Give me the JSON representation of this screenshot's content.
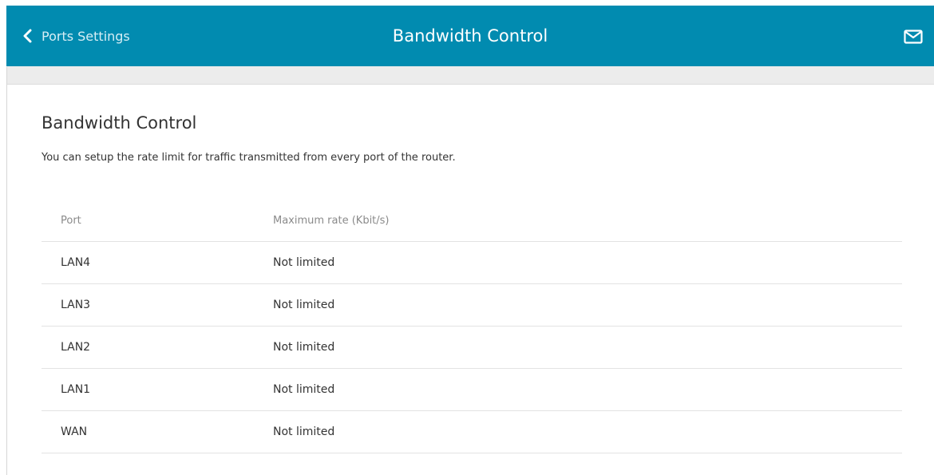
{
  "header": {
    "back_label": "Ports Settings",
    "title": "Bandwidth Control",
    "back_icon": "chevron-left-icon",
    "mail_icon": "mail-icon",
    "bar_color": "#018bb0"
  },
  "section": {
    "title": "Bandwidth Control",
    "description": "You can setup the rate limit for traffic transmitted from every port of the router."
  },
  "table": {
    "columns": [
      "Port",
      "Maximum rate (Kbit/s)"
    ],
    "rows": [
      {
        "port": "LAN4",
        "rate": "Not limited"
      },
      {
        "port": "LAN3",
        "rate": "Not limited"
      },
      {
        "port": "LAN2",
        "rate": "Not limited"
      },
      {
        "port": "LAN1",
        "rate": "Not limited"
      },
      {
        "port": "WAN",
        "rate": "Not limited"
      }
    ]
  }
}
